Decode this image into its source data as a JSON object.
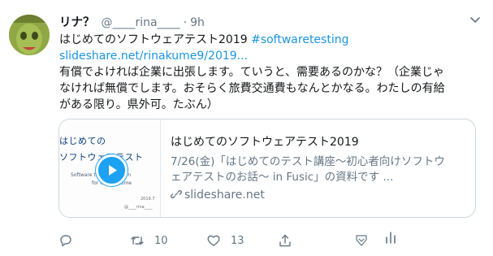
{
  "tweet": {
    "display_name": "リナ？",
    "handle": "@____rina____",
    "separator": "·",
    "time": "9h",
    "text_line1_prefix": "はじめてのソフトウェアテスト2019 ",
    "hashtag": "#softwaretesting",
    "link": "slideshare.net/rinakume9/2019...",
    "body_lines": [
      "有償でよければ企業に出張します。ていうと、需要あるのかな？（企業じゃ",
      "なければ無償でします。おそらく旅費交通費もなんとかなる。わたしの有給",
      "がある限り。県外可。たぶん）"
    ]
  },
  "card": {
    "thumbnail": {
      "title_line1": "はじめての",
      "title_line2": "ソフトウェアテスト",
      "subtitle_line1": "Software testing to learn",
      "subtitle_line2": "for the first time",
      "date": "2019.7",
      "author": "@____rina____"
    },
    "title": "はじめてのソフトウェアテスト2019",
    "description_lines": [
      "7/26(金)「はじめてのテスト講座～初心者向けソフトウ",
      "ェアテストのお話～ in Fusic」の資料です ..."
    ],
    "domain": "slideshare.net"
  },
  "actions": {
    "reply_count": "",
    "retweet_count": "10",
    "like_count": "13"
  },
  "colors": {
    "accent": "#1da1f2",
    "link": "#1b95e0",
    "muted": "#657786",
    "border": "#ccd6dd"
  },
  "icons": [
    "avatar",
    "caret-down-icon",
    "play-icon",
    "link-icon",
    "reply-icon",
    "retweet-icon",
    "like-icon",
    "share-icon",
    "analytics-icon"
  ]
}
